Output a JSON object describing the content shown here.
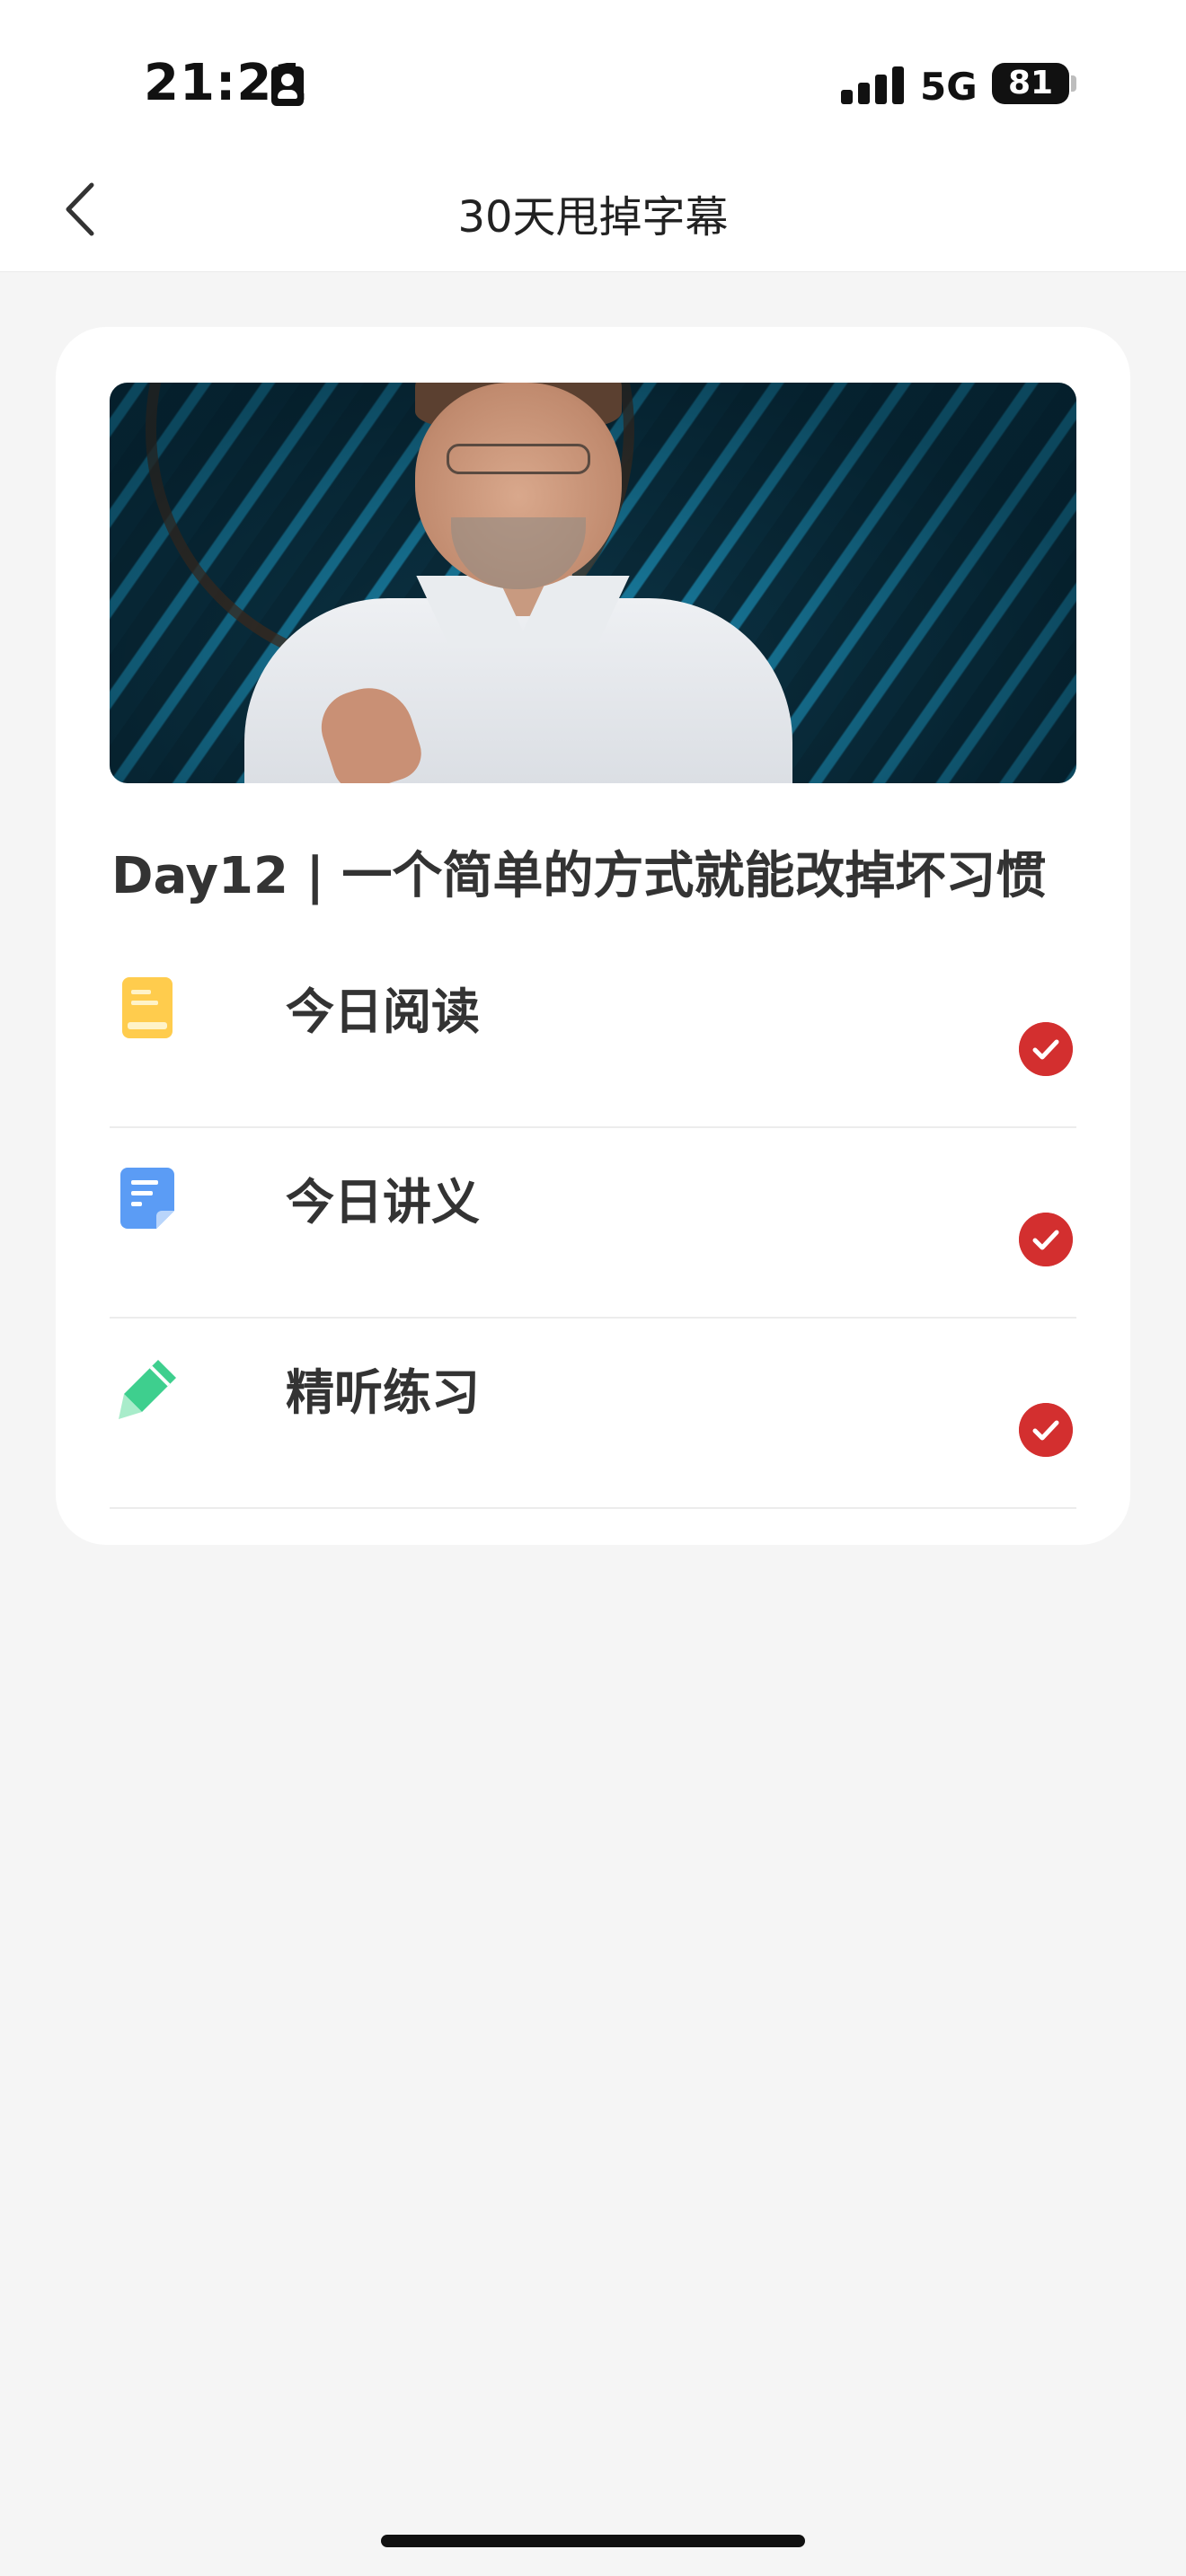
{
  "status_bar": {
    "time": "21:21",
    "network": "5G",
    "battery": "81"
  },
  "nav": {
    "title": "30天甩掉字幕"
  },
  "lesson": {
    "title": "Day12 | 一个简单的方式就能改掉坏习惯"
  },
  "tasks": [
    {
      "label": "今日阅读",
      "icon": "book-icon",
      "completed": true
    },
    {
      "label": "今日讲义",
      "icon": "document-icon",
      "completed": true
    },
    {
      "label": "精听练习",
      "icon": "pencil-icon",
      "completed": true
    }
  ],
  "colors": {
    "accent_check": "#d32f2f",
    "book_icon": "#ffcc4d",
    "document_icon": "#5b9cf5",
    "pencil_icon": "#3ecf8e",
    "page_background": "#f5f5f5"
  }
}
